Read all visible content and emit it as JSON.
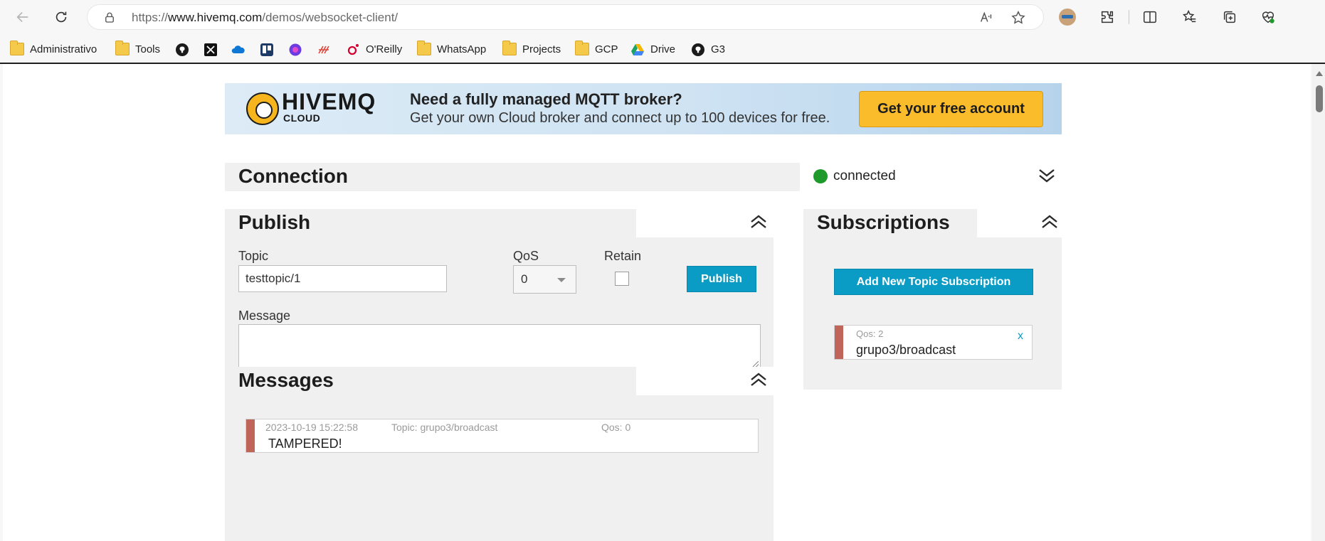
{
  "browser": {
    "url_prefix": "https://",
    "url_host": "www.hivemq.com",
    "url_path": "/demos/websocket-client/"
  },
  "bookmarks": [
    {
      "label": "Administrativo",
      "icon": "folder-icon"
    },
    {
      "label": "Tools",
      "icon": "folder-icon"
    },
    {
      "label": "",
      "icon": "github-icon"
    },
    {
      "label": "",
      "icon": "x-icon"
    },
    {
      "label": "",
      "icon": "onedrive-icon"
    },
    {
      "label": "",
      "icon": "trello-icon"
    },
    {
      "label": "",
      "icon": "copilot-icon"
    },
    {
      "label": "",
      "icon": "app-icon"
    },
    {
      "label": "O'Reilly",
      "icon": "oreilly-icon"
    },
    {
      "label": "WhatsApp",
      "icon": "folder-icon"
    },
    {
      "label": "Projects",
      "icon": "folder-icon"
    },
    {
      "label": "GCP",
      "icon": "folder-icon"
    },
    {
      "label": "Drive",
      "icon": "drive-icon"
    },
    {
      "label": "G3",
      "icon": "github-icon"
    }
  ],
  "banner": {
    "logo_text": "HIVEMQ",
    "logo_sub": "CLOUD",
    "title": "Need a fully managed MQTT broker?",
    "subtitle": "Get your own Cloud broker and connect up to 100 devices for free.",
    "cta": "Get your free account"
  },
  "connection": {
    "title": "Connection",
    "status": "connected",
    "status_color": "#1e9a2a"
  },
  "publish": {
    "title": "Publish",
    "topic_label": "Topic",
    "topic_value": "testtopic/1",
    "qos_label": "QoS",
    "qos_value": "0",
    "retain_label": "Retain",
    "retain_checked": false,
    "button": "Publish",
    "message_label": "Message",
    "message_value": ""
  },
  "subscriptions": {
    "title": "Subscriptions",
    "add_button": "Add New Topic Subscription",
    "items": [
      {
        "qos": "Qos: 2",
        "topic": "grupo3/broadcast",
        "close": "x",
        "color": "#c0655a"
      }
    ]
  },
  "messages": {
    "title": "Messages",
    "items": [
      {
        "timestamp": "2023-10-19 15:22:58",
        "topic": "Topic: grupo3/broadcast",
        "qos": "Qos: 0",
        "payload": "TAMPERED!",
        "color": "#c0655a"
      }
    ]
  },
  "colors": {
    "accent_blue": "#0a9cc5",
    "cta_yellow": "#fbbc2b"
  }
}
